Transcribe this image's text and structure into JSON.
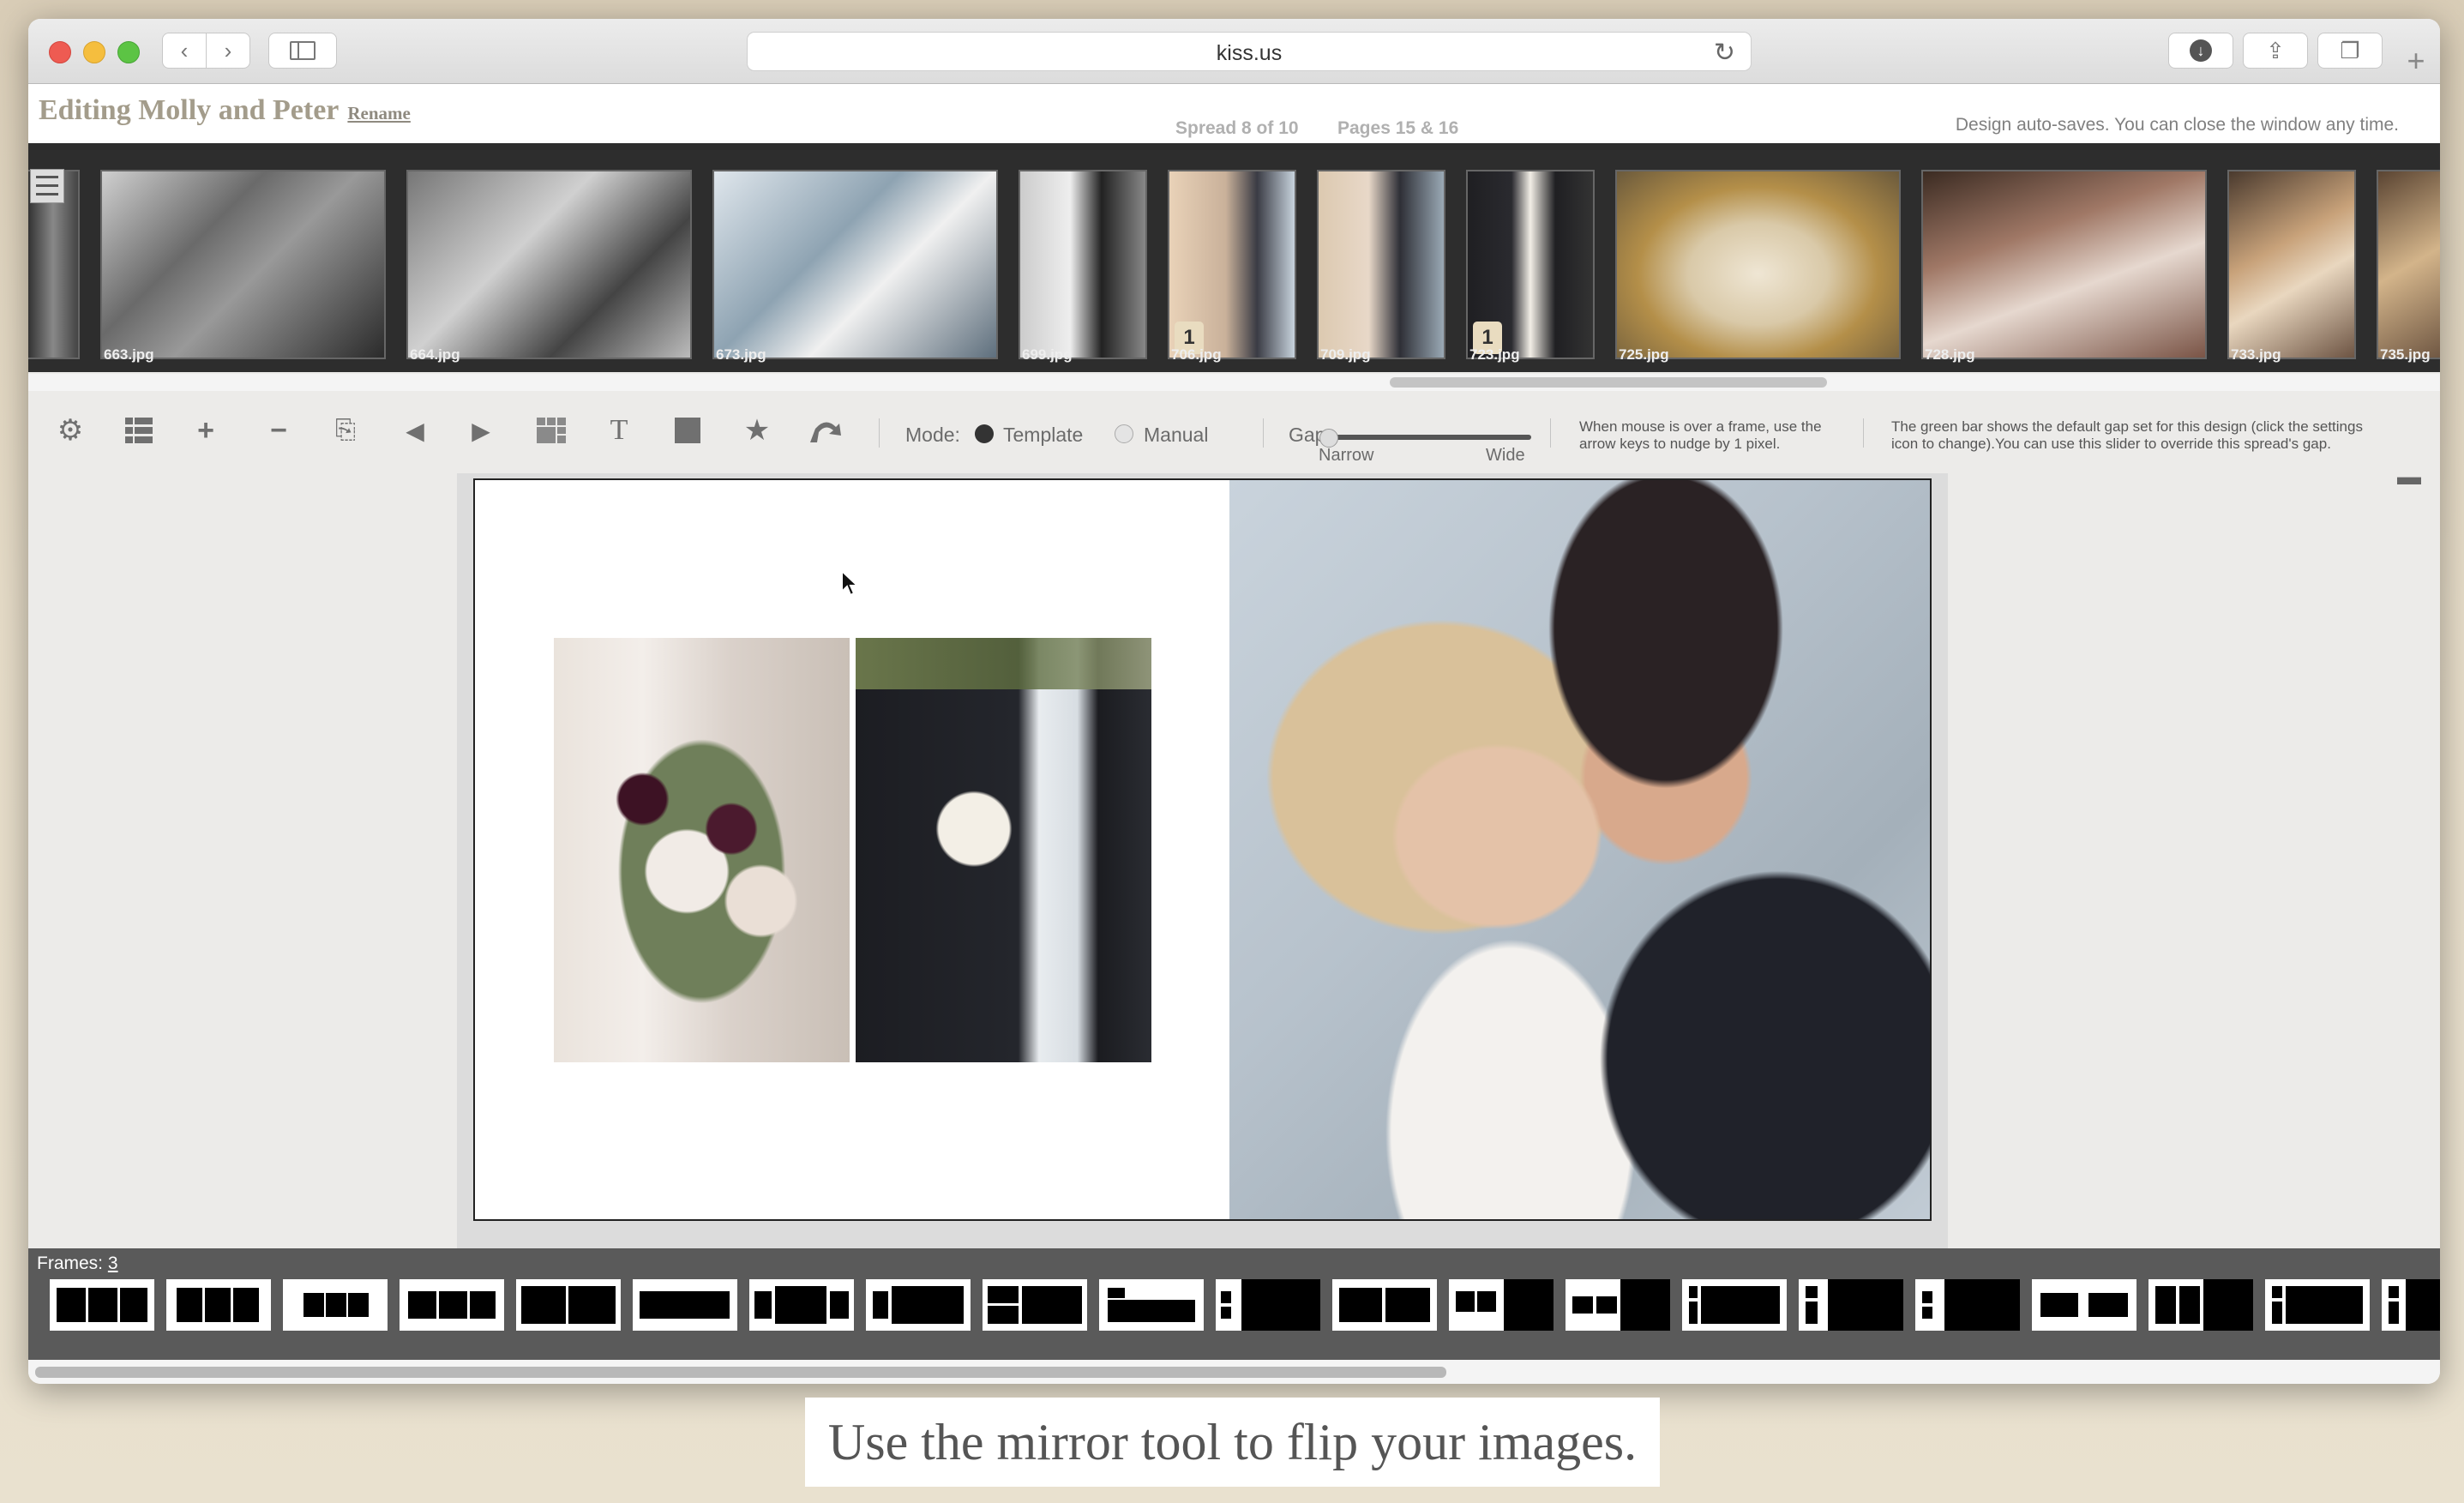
{
  "browser": {
    "url": "kiss.us"
  },
  "editor": {
    "title": "Editing Molly and Peter",
    "rename_label": "Rename",
    "spread_info": "Spread 8 of 10",
    "pages_info": "Pages 15 & 16",
    "autosave_note": "Design auto-saves. You can close the window any time."
  },
  "filmstrip": {
    "thumbnails": [
      {
        "name": "663.jpg"
      },
      {
        "name": "664.jpg"
      },
      {
        "name": "673.jpg"
      },
      {
        "name": "699.jpg"
      },
      {
        "name": "706.jpg",
        "badge": "1"
      },
      {
        "name": "709.jpg"
      },
      {
        "name": "723.jpg",
        "badge": "1"
      },
      {
        "name": "725.jpg"
      },
      {
        "name": "728.jpg"
      },
      {
        "name": "733.jpg"
      },
      {
        "name": "735.jpg"
      }
    ]
  },
  "toolbar": {
    "mode_label": "Mode:",
    "mode_template": "Template",
    "mode_manual": "Manual",
    "mode_selected": "Template",
    "gap_label": "Gap:",
    "gap_narrow": "Narrow",
    "gap_wide": "Wide",
    "nudge_hint_1": "When mouse is over a frame, use the",
    "nudge_hint_2": "arrow keys to nudge by 1 pixel.",
    "gap_hint_1": "The green bar shows the default gap set for this design (click the settings",
    "gap_hint_2": "icon to change).You can use this slider to override this spread's gap."
  },
  "frames": {
    "label": "Frames:",
    "count": "3"
  },
  "caption": "Use the mirror tool to flip your images.",
  "colors": {
    "title_brown": "#a39c8b",
    "filmstrip_bg": "#2d2d2d",
    "frames_bar_bg": "#5a5a5a",
    "badge_bg": "#e9dcc0"
  }
}
